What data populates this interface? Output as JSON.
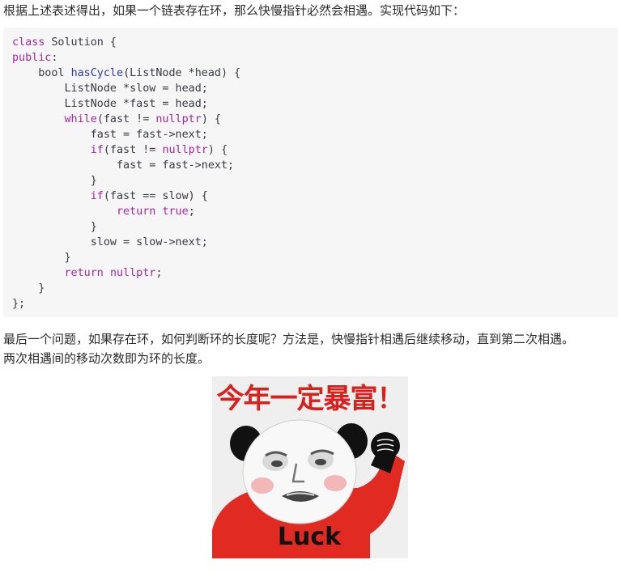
{
  "paragraphs": {
    "intro": "根据上述表述得出，如果一个链表存在环，那么快慢指针必然会相遇。实现代码如下：",
    "question_line1": "最后一个问题，如果存在环，如何判断环的长度呢？方法是，快慢指针相遇后继续移动，直到第二次相遇。",
    "question_line2": "两次相遇间的移动次数即为环的长度。"
  },
  "code": {
    "language": "cpp",
    "lines": [
      [
        [
          "kw",
          "class"
        ],
        [
          "tx",
          " Solution {"
        ]
      ],
      [
        [
          "kw",
          "public"
        ],
        [
          "tx",
          ":"
        ]
      ],
      [
        [
          "tx",
          "    "
        ],
        [
          "ty",
          "bool"
        ],
        [
          "tx",
          " "
        ],
        [
          "fn",
          "hasCycle"
        ],
        [
          "tx",
          "(ListNode *head) {"
        ]
      ],
      [
        [
          "tx",
          "        ListNode *slow = head;"
        ]
      ],
      [
        [
          "tx",
          "        ListNode *fast = head;"
        ]
      ],
      [
        [
          "tx",
          "        "
        ],
        [
          "kw",
          "while"
        ],
        [
          "tx",
          "(fast != "
        ],
        [
          "kw",
          "nullptr"
        ],
        [
          "tx",
          ") {"
        ]
      ],
      [
        [
          "tx",
          "            fast = fast->next;"
        ]
      ],
      [
        [
          "tx",
          "            "
        ],
        [
          "kw",
          "if"
        ],
        [
          "tx",
          "(fast != "
        ],
        [
          "kw",
          "nullptr"
        ],
        [
          "tx",
          ") {"
        ]
      ],
      [
        [
          "tx",
          "                fast = fast->next;"
        ]
      ],
      [
        [
          "tx",
          "            }"
        ]
      ],
      [
        [
          "tx",
          "            "
        ],
        [
          "kw",
          "if"
        ],
        [
          "tx",
          "(fast == slow) {"
        ]
      ],
      [
        [
          "tx",
          "                "
        ],
        [
          "kw",
          "return"
        ],
        [
          "tx",
          " "
        ],
        [
          "kw",
          "true"
        ],
        [
          "tx",
          ";"
        ]
      ],
      [
        [
          "tx",
          "            }"
        ]
      ],
      [
        [
          "tx",
          "            slow = slow->next;"
        ]
      ],
      [
        [
          "tx",
          "        }"
        ]
      ],
      [
        [
          "tx",
          "        "
        ],
        [
          "kw",
          "return"
        ],
        [
          "tx",
          " "
        ],
        [
          "kw",
          "nullptr"
        ],
        [
          "tx",
          ";"
        ]
      ],
      [
        [
          "tx",
          "    }"
        ]
      ],
      [
        [
          "tx",
          "};"
        ]
      ]
    ]
  },
  "meme": {
    "caption": "今年一定暴富！",
    "shirt_text": "Luck",
    "colors": {
      "caption": "#d8201c",
      "shirt": "#e02a22",
      "background": "#efefef"
    }
  }
}
